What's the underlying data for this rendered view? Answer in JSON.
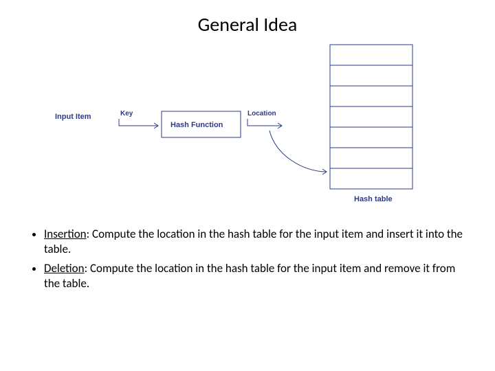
{
  "title": "General Idea",
  "diagram": {
    "input_item": "Input Item",
    "key": "Key",
    "hash_function": "Hash Function",
    "location": "Location",
    "hash_table": "Hash table"
  },
  "bullets": {
    "insertion_label": "Insertion",
    "insertion_rest": ": Compute the location in the hash table for the input item and insert it into the table.",
    "deletion_label": "Deletion",
    "deletion_rest": ": Compute the location in the hash table for the input item and remove it from the table."
  }
}
